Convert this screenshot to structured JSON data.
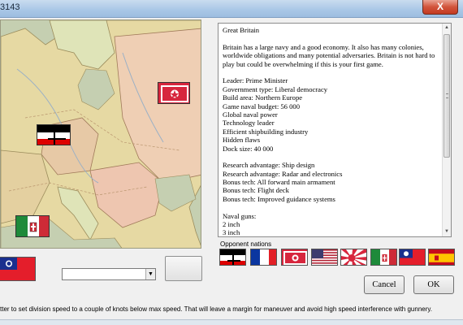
{
  "window": {
    "title": "3143",
    "close_symbol": "X"
  },
  "description": {
    "lines": [
      "Great Britain",
      "",
      "Britain has a large navy and a good economy. It also has many colonies, worldwide obligations and many potential adversaries. Britain is not hard to play but could be overwhelming if this is your first game.",
      "",
      "Leader: Prime Minister",
      "Government type: Liberal democracy",
      "Build area: Northern Europe",
      "Game naval budget: 56 000",
      "Global naval power",
      "Technology leader",
      "Efficient shipbuilding industry",
      "Hidden flaws",
      "Dock size: 40 000",
      "",
      "Research advantage: Ship design",
      "Research advantage: Radar and electronics",
      "Bonus tech: All forward main armament",
      "Bonus tech: Flight deck",
      "Bonus tech: Improved guidance systems",
      "",
      "Naval guns:",
      "2 inch",
      "3 inch"
    ]
  },
  "scrollbar": {
    "up_symbol": "▲",
    "down_symbol": "▼"
  },
  "opponents": {
    "label": "Opponent nations",
    "flags": [
      {
        "icon": "german-imperial-flag-icon"
      },
      {
        "icon": "french-flag-icon"
      },
      {
        "icon": "japanese-naval-flag-icon"
      },
      {
        "icon": "us-flag-icon"
      },
      {
        "icon": "rising-sun-flag-icon"
      },
      {
        "icon": "italian-flag-icon"
      },
      {
        "icon": "roc-flag-icon"
      },
      {
        "icon": "spanish-flag-icon"
      }
    ]
  },
  "controls": {
    "combo_value": "",
    "combo_arrow": "▼",
    "cancel_label": "Cancel",
    "ok_label": "OK"
  },
  "hint": "tter to set division speed to a couple of knots below max speed. That will leave a margin for maneuver and avoid high speed interference with gunnery.",
  "colors": {
    "map_sea": "#c9d1b6",
    "map_land": "#e8dca6",
    "german_flag": [
      "#000000",
      "#ffffff",
      "#dd0000"
    ]
  }
}
